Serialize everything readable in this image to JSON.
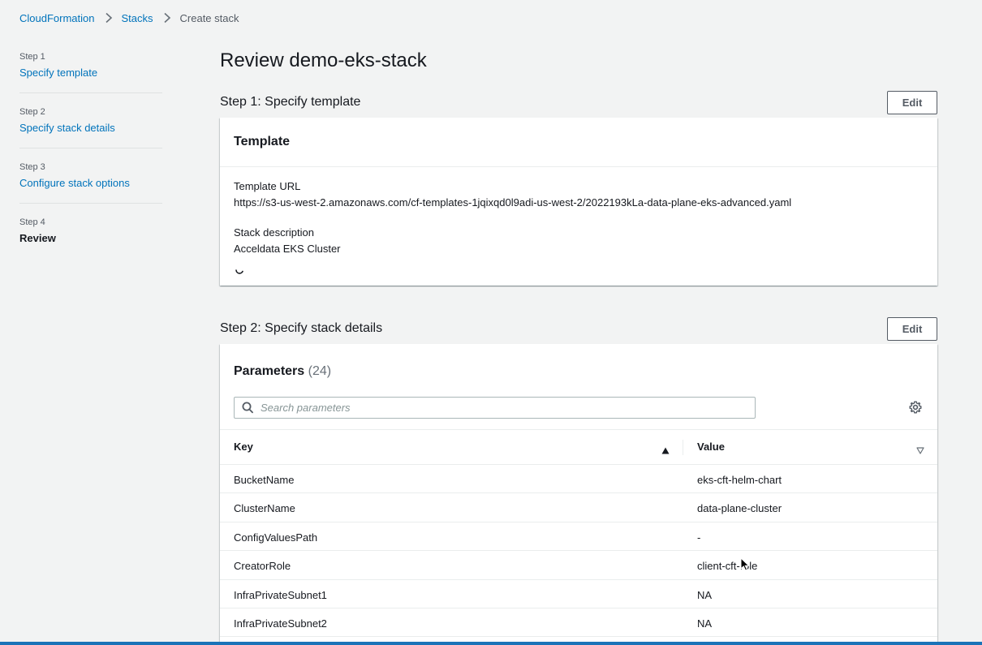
{
  "breadcrumb": {
    "items": [
      "CloudFormation",
      "Stacks"
    ],
    "current": "Create stack"
  },
  "steps": [
    {
      "num": "Step 1",
      "label": "Specify template"
    },
    {
      "num": "Step 2",
      "label": "Specify stack details"
    },
    {
      "num": "Step 3",
      "label": "Configure stack options"
    },
    {
      "num": "Step 4",
      "label": "Review"
    }
  ],
  "page_title": "Review demo-eks-stack",
  "section1": {
    "title": "Step 1: Specify template",
    "edit_label": "Edit",
    "card_title": "Template",
    "template_url_label": "Template URL",
    "template_url": "https://s3-us-west-2.amazonaws.com/cf-templates-1jqixqd0l9adi-us-west-2/2022193kLa-data-plane-eks-advanced.yaml",
    "desc_label": "Stack description",
    "desc_value": "Acceldata EKS Cluster"
  },
  "section2": {
    "title": "Step 2: Specify stack details",
    "edit_label": "Edit",
    "card_title": "Parameters",
    "count": "(24)",
    "search_placeholder": "Search parameters",
    "col_key": "Key",
    "col_value": "Value",
    "rows": [
      {
        "key": "BucketName",
        "value": "eks-cft-helm-chart"
      },
      {
        "key": "ClusterName",
        "value": "data-plane-cluster"
      },
      {
        "key": "ConfigValuesPath",
        "value": "-"
      },
      {
        "key": "CreatorRole",
        "value": "client-cft-role"
      },
      {
        "key": "InfraPrivateSubnet1",
        "value": "NA"
      },
      {
        "key": "InfraPrivateSubnet2",
        "value": "NA"
      }
    ]
  },
  "colors": {
    "link": "#0073bb",
    "background": "#f2f3f3",
    "text": "#16191f",
    "bottom_bar": "#1a73b8"
  },
  "icons": [
    "chevron-right-icon",
    "spinner-icon",
    "search-icon",
    "gear-icon",
    "sort-ascending-icon",
    "sort-descending-icon",
    "mouse-cursor-icon"
  ]
}
